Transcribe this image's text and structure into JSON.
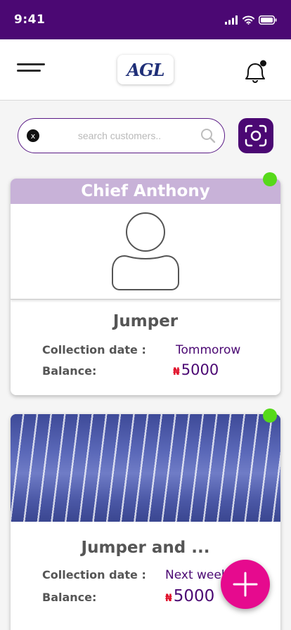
{
  "status_bar": {
    "time": "9:41"
  },
  "header": {
    "logo_text": "AGL"
  },
  "search": {
    "placeholder": "search customers..",
    "value": "",
    "clear_label": "x"
  },
  "customers": [
    {
      "name": "Chief Anthony",
      "item": "Jumper",
      "collection_label": "Collection date :",
      "collection_date": "Tommorow",
      "balance_label": "Balance:",
      "currency_symbol": "₦",
      "balance": "5000",
      "online": true,
      "image": "avatar-placeholder"
    },
    {
      "item": "Jumper and ...",
      "collection_label": "Collection date :",
      "collection_date": "Next week",
      "balance_label": "Balance:",
      "currency_symbol": "₦",
      "balance": "5000",
      "online": true,
      "image": "striped-blue-fabric-photo"
    }
  ],
  "colors": {
    "primary": "#4b0873",
    "card_header": "#c8b2d8",
    "online": "#56d91a",
    "fab": "#e60a8e",
    "currency": "#e0102a"
  },
  "icons": [
    "menu-icon",
    "bell-icon",
    "search-icon",
    "scan-icon",
    "plus-icon",
    "user-icon",
    "signal-icon",
    "wifi-icon",
    "battery-icon"
  ]
}
